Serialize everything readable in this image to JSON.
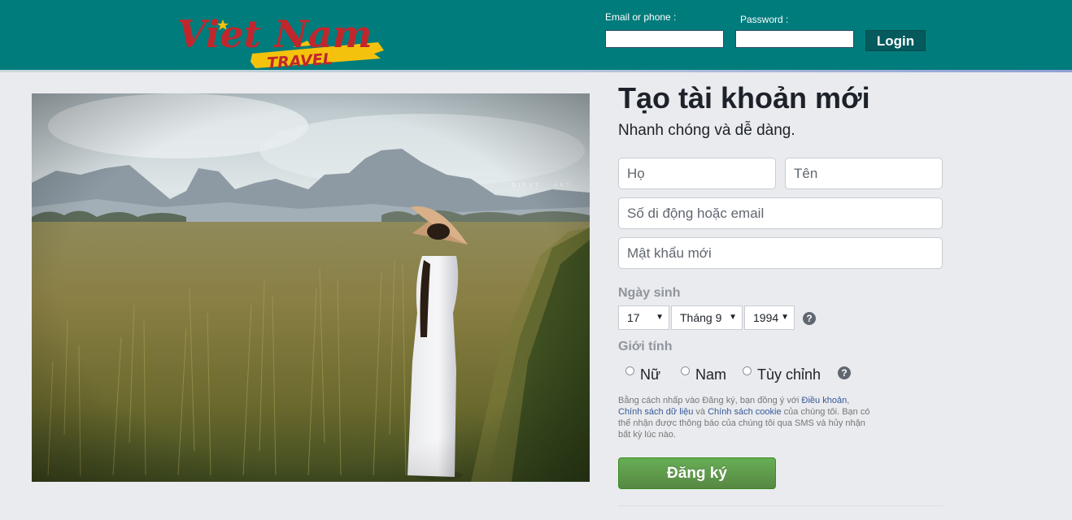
{
  "header": {
    "logo_main": "Viet Nam",
    "logo_sub": "TRAVEL",
    "email_label": "Email or phone :",
    "password_label": "Password :",
    "login_button": "Login"
  },
  "signup": {
    "title": "Tạo tài khoản mới",
    "subtitle": "Nhanh chóng và dễ dàng.",
    "first_name_placeholder": "Họ",
    "last_name_placeholder": "Tên",
    "contact_placeholder": "Số di động hoặc email",
    "password_placeholder": "Mật khẩu mới",
    "birthday_label": "Ngày sinh",
    "birthday": {
      "day": "17",
      "month": "Tháng 9",
      "year": "1994"
    },
    "gender_label": "Giới tính",
    "genders": [
      "Nữ",
      "Nam",
      "Tùy chỉnh"
    ],
    "terms": {
      "part1": "Bằng cách nhấp vào Đăng ký, bạn đồng ý với ",
      "link_terms": "Điều khoản",
      "sep1": ", ",
      "link_data": "Chính sách dữ liệu",
      "sep2": " và ",
      "link_cookie": "Chính sách cookie",
      "part2": " của chúng tôi. Bạn có thể nhận được thông báo của chúng tôi qua SMS và hủy nhận bất kỳ lúc nào."
    },
    "submit_button": "Đăng ký"
  },
  "colors": {
    "header_bg": "#007c7c",
    "login_button_bg": "#045a5d",
    "submit_green": "#5fa04a",
    "link": "#385898"
  }
}
